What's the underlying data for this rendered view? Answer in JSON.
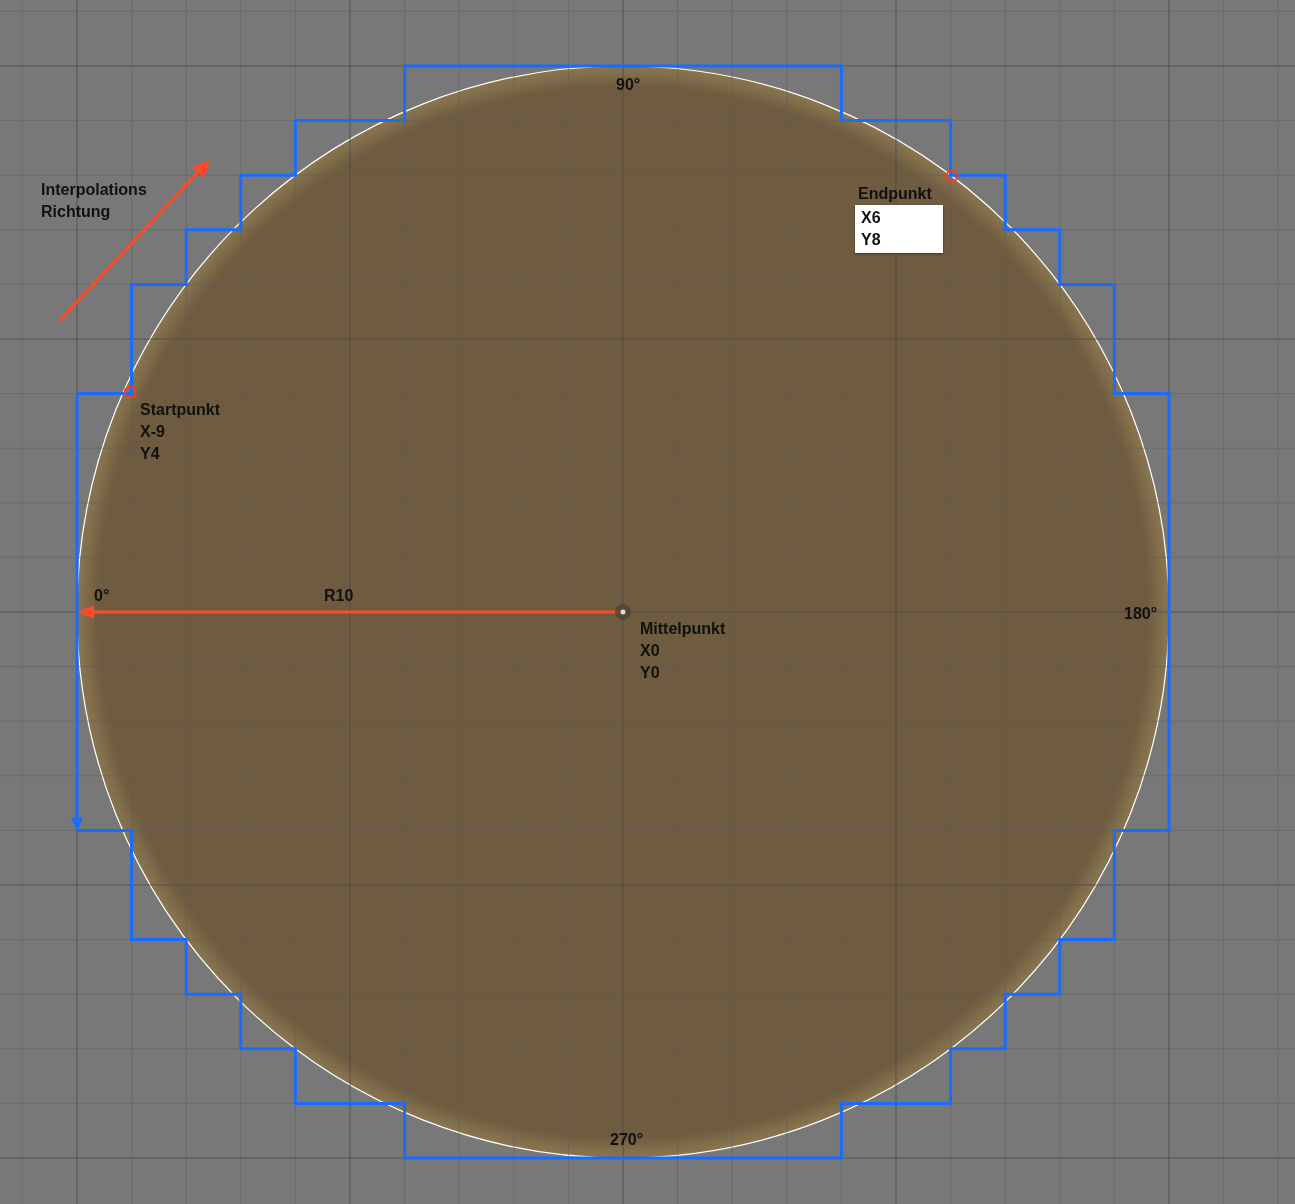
{
  "canvas": {
    "angle_labels": {
      "top": "90°",
      "left": "0°",
      "right": "180°",
      "bottom": "270°"
    },
    "direction_label": "Interpolations Richtung",
    "radius_label": "R10",
    "start_point": {
      "title": "Startpunkt",
      "x": "X-9",
      "y": "Y4"
    },
    "end_point": {
      "title": "Endpunkt",
      "x": "X6",
      "y": "Y8"
    },
    "center_point": {
      "title": "Mittelpunkt",
      "x": "X0",
      "y": "Y0"
    }
  }
}
